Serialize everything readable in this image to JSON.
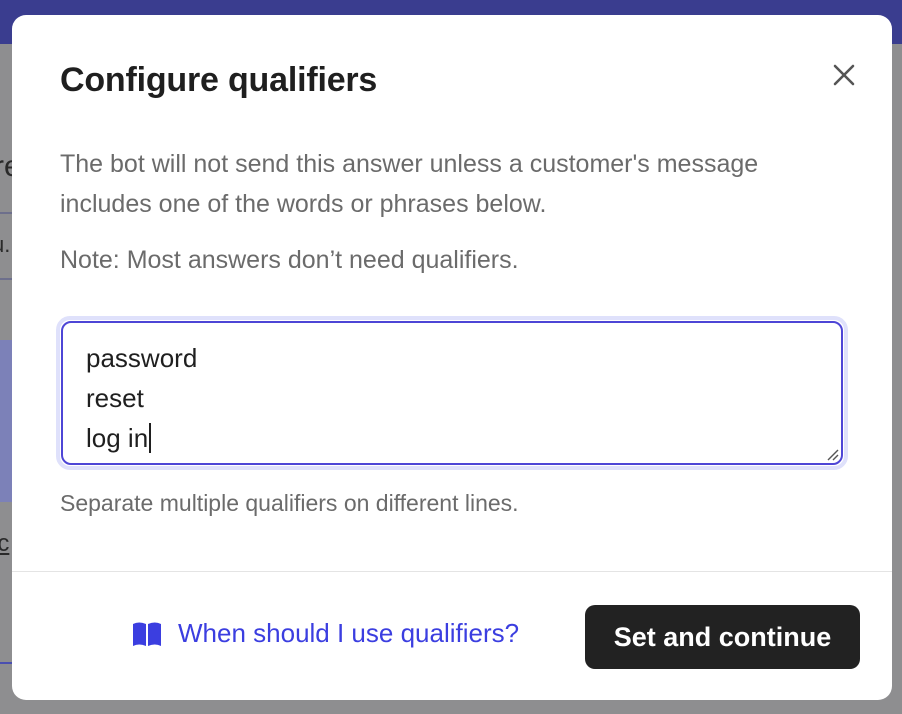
{
  "background": {
    "fragments": [
      "re",
      "u.",
      "ic"
    ]
  },
  "modal": {
    "title": "Configure qualifiers",
    "close_icon": "close-icon",
    "description": "The bot will not send this answer unless a customer's message includes one of the words or phrases below.",
    "note": "Note: Most answers don’t need qualifiers.",
    "qualifiers": [
      "password",
      "reset",
      "log in"
    ],
    "helper_text": "Separate multiple qualifiers on different lines.",
    "help_link": {
      "icon": "book-icon",
      "label": "When should I use qualifiers?"
    },
    "primary_button_label": "Set and continue"
  },
  "colors": {
    "accent": "#4e46d6",
    "link": "#3b3ee0",
    "primary_button": "#222222",
    "overlay": "#8e8e90",
    "backdrop_header": "#3a3d8f"
  }
}
